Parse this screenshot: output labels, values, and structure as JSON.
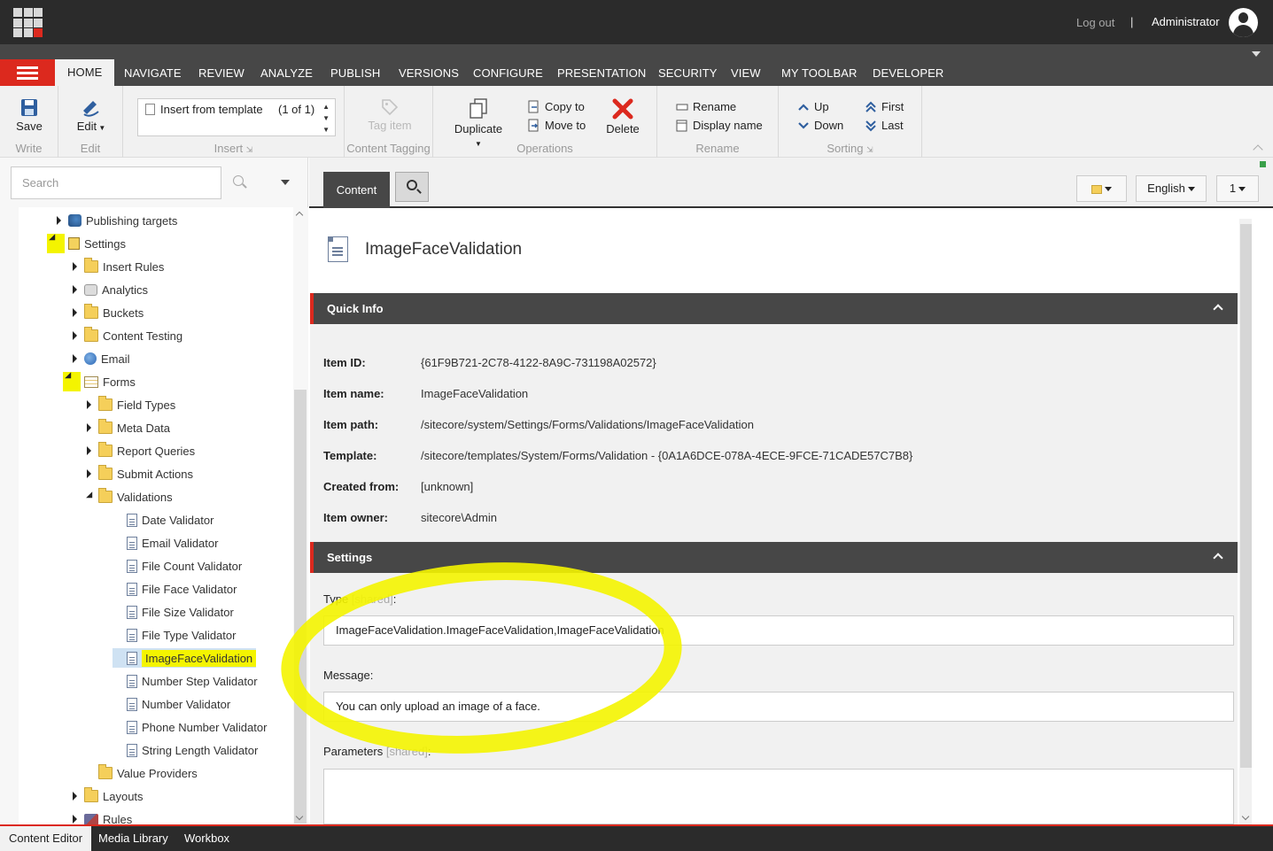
{
  "topbar": {
    "logout": "Log out",
    "separator": "|",
    "user": "Administrator"
  },
  "menu": {
    "tabs": [
      "HOME",
      "NAVIGATE",
      "REVIEW",
      "ANALYZE",
      "PUBLISH",
      "VERSIONS",
      "CONFIGURE",
      "PRESENTATION",
      "SECURITY",
      "VIEW",
      "MY TOOLBAR",
      "DEVELOPER"
    ],
    "active_tab": "HOME"
  },
  "ribbon": {
    "write": {
      "label": "Write",
      "save": "Save"
    },
    "edit": {
      "label": "Edit",
      "edit": "Edit"
    },
    "insert": {
      "label": "Insert",
      "template": "Insert from template",
      "count": "(1 of 1)"
    },
    "tagging": {
      "label": "Content Tagging",
      "tag_item": "Tag item"
    },
    "operations": {
      "label": "Operations",
      "duplicate": "Duplicate",
      "copy_to": "Copy to",
      "move_to": "Move to",
      "delete": "Delete"
    },
    "rename": {
      "label": "Rename",
      "rename": "Rename",
      "display_name": "Display name"
    },
    "sorting": {
      "label": "Sorting",
      "up": "Up",
      "down": "Down",
      "first": "First",
      "last": "Last"
    }
  },
  "search": {
    "placeholder": "Search"
  },
  "tree": {
    "items": [
      {
        "label": "Publishing targets",
        "level": 0,
        "expander": "closed",
        "icon": "publishing-icon"
      },
      {
        "label": "Settings",
        "level": 0,
        "expander": "open",
        "icon": "settings-icon"
      },
      {
        "label": "Insert Rules",
        "level": 1,
        "expander": "closed",
        "icon": "folder-icon"
      },
      {
        "label": "Analytics",
        "level": 1,
        "expander": "closed",
        "icon": "analytics-icon"
      },
      {
        "label": "Buckets",
        "level": 1,
        "expander": "closed",
        "icon": "folder-icon"
      },
      {
        "label": "Content Testing",
        "level": 1,
        "expander": "closed",
        "icon": "folder-icon"
      },
      {
        "label": "Email",
        "level": 1,
        "expander": "closed",
        "icon": "globe-icon"
      },
      {
        "label": "Forms",
        "level": 1,
        "expander": "open",
        "icon": "forms-icon"
      },
      {
        "label": "Field Types",
        "level": 2,
        "expander": "closed",
        "icon": "folder-icon"
      },
      {
        "label": "Meta Data",
        "level": 2,
        "expander": "closed",
        "icon": "folder-icon"
      },
      {
        "label": "Report Queries",
        "level": 2,
        "expander": "closed",
        "icon": "folder-icon"
      },
      {
        "label": "Submit Actions",
        "level": 2,
        "expander": "closed",
        "icon": "folder-icon"
      },
      {
        "label": "Validations",
        "level": 2,
        "expander": "open",
        "icon": "folder-icon"
      },
      {
        "label": "Date Validator",
        "level": 3,
        "expander": "none",
        "icon": "document-icon"
      },
      {
        "label": "Email Validator",
        "level": 3,
        "expander": "none",
        "icon": "document-icon"
      },
      {
        "label": "File Count Validator",
        "level": 3,
        "expander": "none",
        "icon": "document-icon"
      },
      {
        "label": "File Face Validator",
        "level": 3,
        "expander": "none",
        "icon": "document-icon"
      },
      {
        "label": "File Size Validator",
        "level": 3,
        "expander": "none",
        "icon": "document-icon"
      },
      {
        "label": "File Type Validator",
        "level": 3,
        "expander": "none",
        "icon": "document-icon"
      },
      {
        "label": "ImageFaceValidation",
        "level": 3,
        "expander": "none",
        "icon": "document-icon",
        "selected": true
      },
      {
        "label": "Number Step Validator",
        "level": 3,
        "expander": "none",
        "icon": "document-icon"
      },
      {
        "label": "Number Validator",
        "level": 3,
        "expander": "none",
        "icon": "document-icon"
      },
      {
        "label": "Phone Number Validator",
        "level": 3,
        "expander": "none",
        "icon": "document-icon"
      },
      {
        "label": "String Length Validator",
        "level": 3,
        "expander": "none",
        "icon": "document-icon"
      },
      {
        "label": "Value Providers",
        "level": 2,
        "expander": "none",
        "icon": "folder-icon"
      },
      {
        "label": "Layouts",
        "level": 1,
        "expander": "closed",
        "icon": "folder-icon"
      },
      {
        "label": "Rules",
        "level": 1,
        "expander": "closed",
        "icon": "rules-icon"
      }
    ]
  },
  "editor": {
    "content_tab": "Content",
    "language": "English",
    "version": "1",
    "item_title": "ImageFaceValidation",
    "quick_info": {
      "title": "Quick Info",
      "rows": [
        {
          "label": "Item ID:",
          "value": "{61F9B721-2C78-4122-8A9C-731198A02572}"
        },
        {
          "label": "Item name:",
          "value": "ImageFaceValidation"
        },
        {
          "label": "Item path:",
          "value": "/sitecore/system/Settings/Forms/Validations/ImageFaceValidation"
        },
        {
          "label": "Template:",
          "value": "/sitecore/templates/System/Forms/Validation - {0A1A6DCE-078A-4ECE-9FCE-71CADE57C7B8}"
        },
        {
          "label": "Created from:",
          "value": "[unknown]"
        },
        {
          "label": "Item owner:",
          "value": "sitecore\\Admin"
        }
      ]
    },
    "settings": {
      "title": "Settings",
      "type_label": "Type",
      "type_shared": "[shared]",
      "type_colon": ":",
      "type_value": "ImageFaceValidation.ImageFaceValidation,ImageFaceValidation",
      "message_label": "Message:",
      "message_value": "You can only upload an image of a face.",
      "parameters_label": "Parameters",
      "parameters_shared": "[shared]",
      "parameters_colon": ":",
      "parameters_value": ""
    }
  },
  "bottom": {
    "tabs": [
      "Content Editor",
      "Media Library",
      "Workbox"
    ],
    "active": "Content Editor"
  },
  "colors": {
    "accent_red": "#dc291e",
    "dark_bar": "#2b2b2b",
    "tab_bar": "#474747",
    "highlight_yellow": "#f4f400"
  }
}
